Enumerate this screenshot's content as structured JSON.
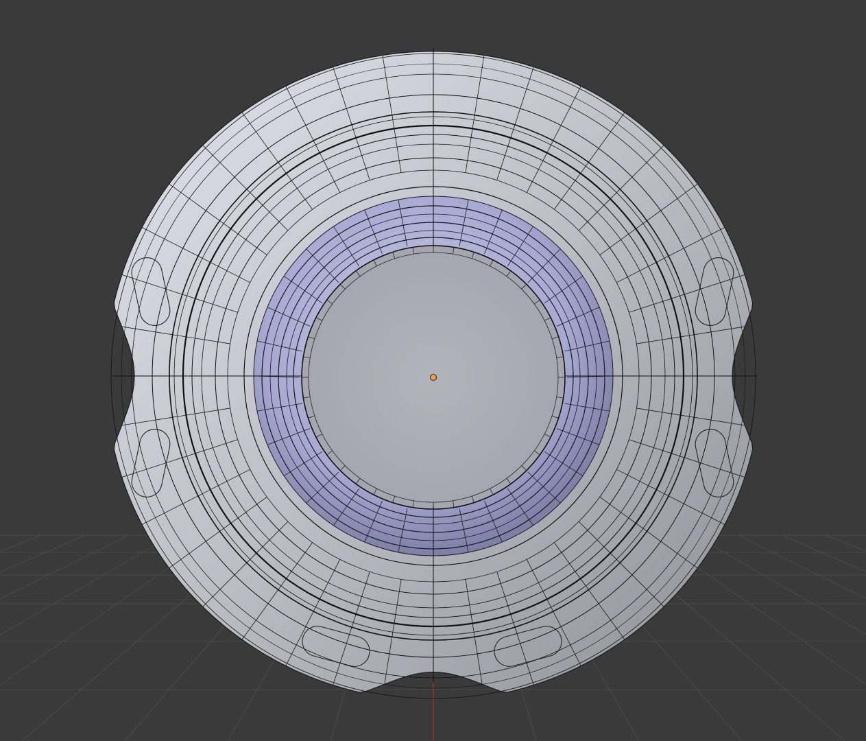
{
  "viewport": {
    "background": "#3a3a3a",
    "grid_color": "#4a4a4a",
    "axis_z_color": "#9b2f2f",
    "origin_color": "#e8a24c"
  },
  "object": {
    "base_color": "#c4c4cc",
    "highlight_color": "#e6e6f2",
    "inner_tint": "#a9acd6",
    "wire_color": "#141414"
  }
}
